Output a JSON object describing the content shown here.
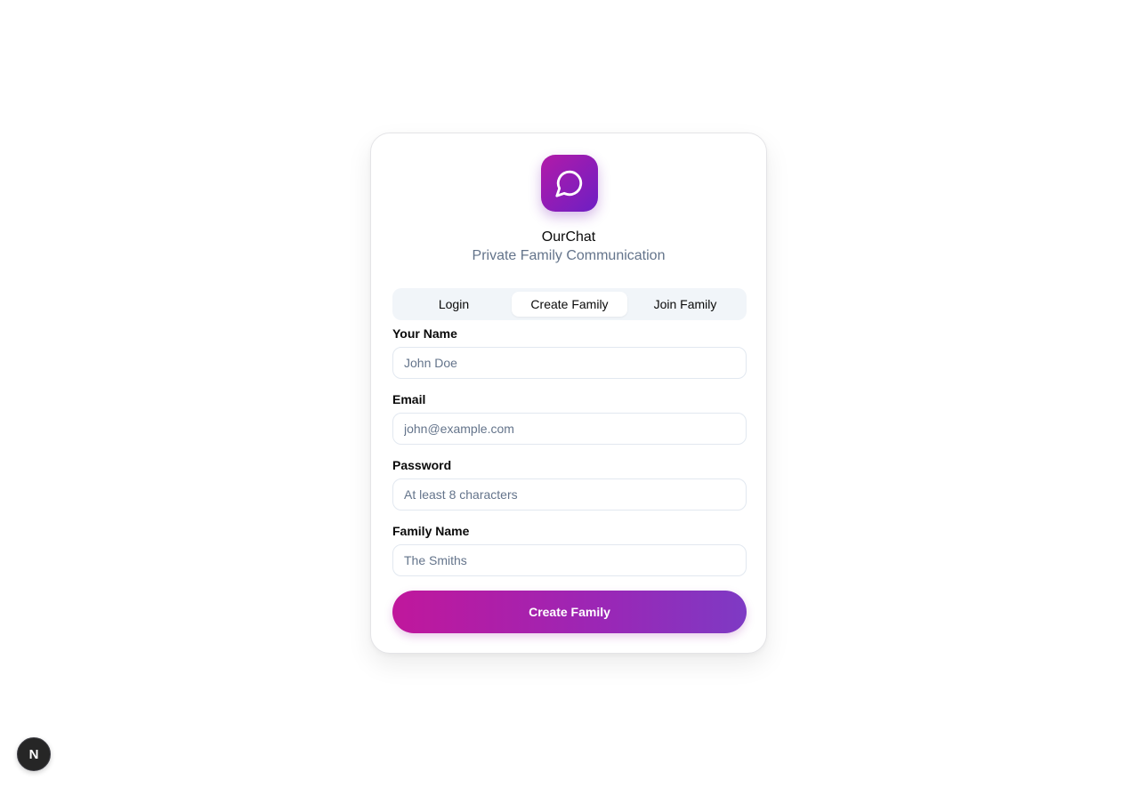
{
  "app": {
    "title": "OurChat",
    "subtitle": "Private Family Communication",
    "logo_icon": "chat-bubble-icon",
    "accent_start": "#c0179c",
    "accent_end": "#7e3ac4"
  },
  "tabs": [
    {
      "label": "Login",
      "active": false
    },
    {
      "label": "Create Family",
      "active": true
    },
    {
      "label": "Join Family",
      "active": false
    }
  ],
  "form": {
    "fields": [
      {
        "label": "Your Name",
        "placeholder": "John Doe",
        "value": ""
      },
      {
        "label": "Email",
        "placeholder": "john@example.com",
        "value": ""
      },
      {
        "label": "Password",
        "placeholder": "At least 8 characters",
        "value": ""
      },
      {
        "label": "Family Name",
        "placeholder": "The Smiths",
        "value": ""
      }
    ],
    "submit_label": "Create Family"
  },
  "devtools": {
    "badge_letter": "N"
  }
}
